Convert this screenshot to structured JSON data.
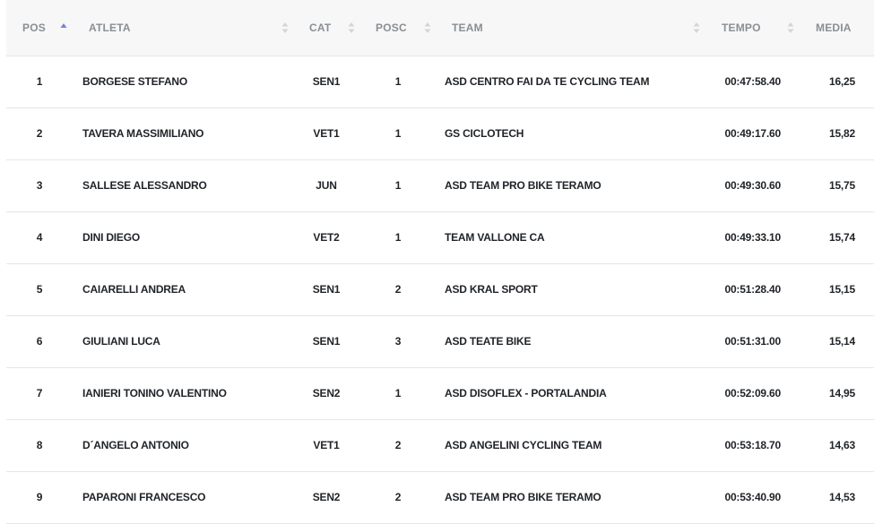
{
  "table": {
    "headers": {
      "pos": "POS",
      "atleta": "ATLETA",
      "cat": "CAT",
      "posc": "POSC",
      "team": "TEAM",
      "tempo": "TEMPO",
      "media": "MEDIA"
    },
    "sort": {
      "column": "pos",
      "direction": "ascending"
    },
    "colors": {
      "sort_active": "#6f86d6",
      "sort_inactive": "#d3d5d8",
      "header_bg": "#f7f7f7",
      "row_border": "#e6e6e6"
    },
    "rows": [
      {
        "pos": "1",
        "atleta": "BORGESE STEFANO",
        "cat": "SEN1",
        "posc": "1",
        "team": "ASD CENTRO FAI DA TE CYCLING TEAM",
        "tempo": "00:47:58.40",
        "media": "16,25"
      },
      {
        "pos": "2",
        "atleta": "TAVERA MASSIMILIANO",
        "cat": "VET1",
        "posc": "1",
        "team": "GS CICLOTECH",
        "tempo": "00:49:17.60",
        "media": "15,82"
      },
      {
        "pos": "3",
        "atleta": "SALLESE ALESSANDRO",
        "cat": "JUN",
        "posc": "1",
        "team": "ASD TEAM PRO BIKE TERAMO",
        "tempo": "00:49:30.60",
        "media": "15,75"
      },
      {
        "pos": "4",
        "atleta": "DINI DIEGO",
        "cat": "VET2",
        "posc": "1",
        "team": "TEAM VALLONE CA",
        "tempo": "00:49:33.10",
        "media": "15,74"
      },
      {
        "pos": "5",
        "atleta": "CAIARELLI ANDREA",
        "cat": "SEN1",
        "posc": "2",
        "team": "ASD KRAL SPORT",
        "tempo": "00:51:28.40",
        "media": "15,15"
      },
      {
        "pos": "6",
        "atleta": "GIULIANI LUCA",
        "cat": "SEN1",
        "posc": "3",
        "team": "ASD TEATE BIKE",
        "tempo": "00:51:31.00",
        "media": "15,14"
      },
      {
        "pos": "7",
        "atleta": "IANIERI TONINO VALENTINO",
        "cat": "SEN2",
        "posc": "1",
        "team": "ASD DISOFLEX - PORTALANDIA",
        "tempo": "00:52:09.60",
        "media": "14,95"
      },
      {
        "pos": "8",
        "atleta": "D´ANGELO ANTONIO",
        "cat": "VET1",
        "posc": "2",
        "team": "ASD ANGELINI CYCLING TEAM",
        "tempo": "00:53:18.70",
        "media": "14,63"
      },
      {
        "pos": "9",
        "atleta": "PAPARONI FRANCESCO",
        "cat": "SEN2",
        "posc": "2",
        "team": "ASD TEAM PRO BIKE TERAMO",
        "tempo": "00:53:40.90",
        "media": "14,53"
      }
    ]
  }
}
